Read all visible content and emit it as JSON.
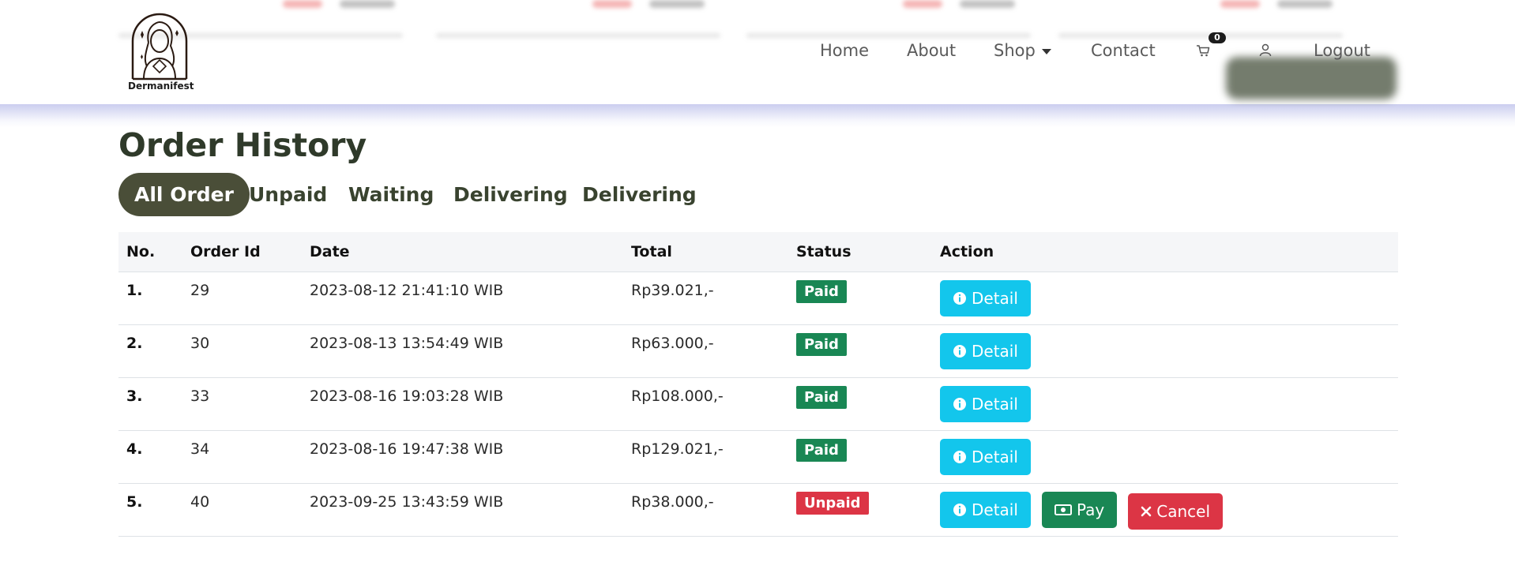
{
  "brand": {
    "name": "Dermanifest"
  },
  "nav": {
    "home": "Home",
    "about": "About",
    "shop": "Shop",
    "contact": "Contact",
    "cart_count": "0",
    "logout": "Logout"
  },
  "page": {
    "title": "Order History"
  },
  "tabs": [
    "All Order",
    "Unpaid",
    "Waiting",
    "Delivering",
    "Delivering"
  ],
  "table": {
    "headers": [
      "No.",
      "Order Id",
      "Date",
      "Total",
      "Status",
      "Action"
    ],
    "rows": [
      {
        "no": "1.",
        "order_id": "29",
        "date": "2023-08-12 21:41:10 WIB",
        "total": "Rp39.021,-",
        "status": "Paid"
      },
      {
        "no": "2.",
        "order_id": "30",
        "date": "2023-08-13 13:54:49 WIB",
        "total": "Rp63.000,-",
        "status": "Paid"
      },
      {
        "no": "3.",
        "order_id": "33",
        "date": "2023-08-16 19:03:28 WIB",
        "total": "Rp108.000,-",
        "status": "Paid"
      },
      {
        "no": "4.",
        "order_id": "34",
        "date": "2023-08-16 19:47:38 WIB",
        "total": "Rp129.021,-",
        "status": "Paid"
      },
      {
        "no": "5.",
        "order_id": "40",
        "date": "2023-09-25 13:43:59 WIB",
        "total": "Rp38.000,-",
        "status": "Unpaid"
      }
    ]
  },
  "actions": {
    "detail": "Detail",
    "pay": "Pay",
    "cancel": "Cancel"
  },
  "colors": {
    "paid": "#198754",
    "unpaid": "#dc3545",
    "detail": "#13c6ec",
    "active_tab": "#4a4e38",
    "title": "#2f3a2a"
  },
  "icons": {
    "cart": "cart-icon",
    "user": "user-icon",
    "info": "info-circle-icon",
    "money": "cash-icon",
    "close": "x-icon",
    "caret": "chevron-down-icon"
  }
}
